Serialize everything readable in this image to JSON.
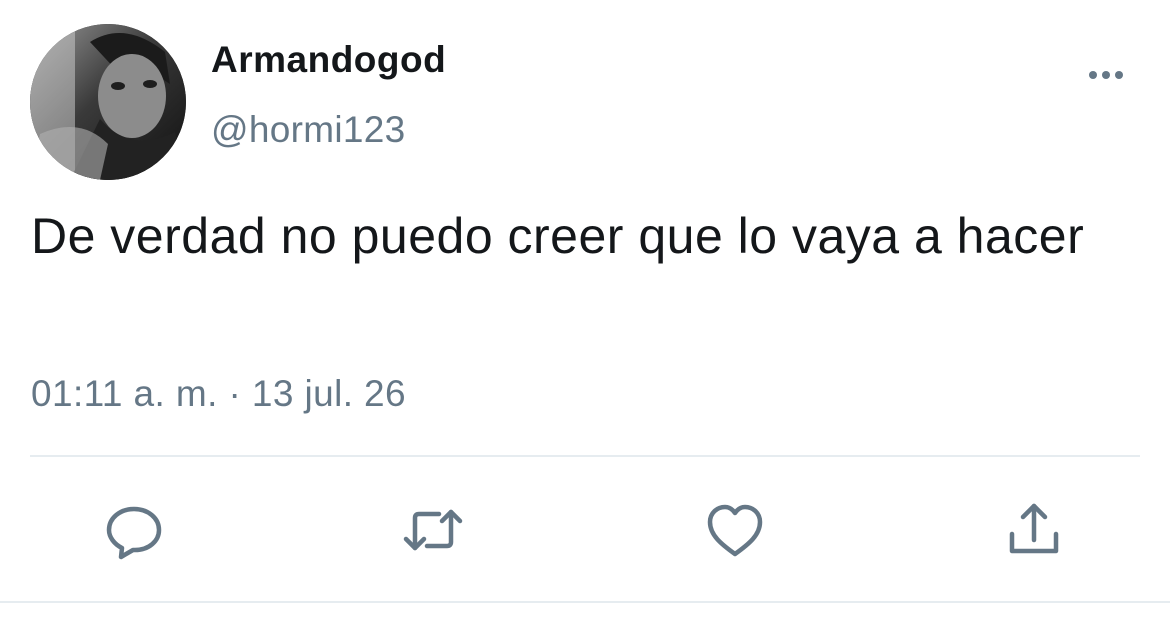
{
  "tweet": {
    "display_name": "Armandogod",
    "handle": "@hormi123",
    "text": "De verdad no puedo creer que lo vaya a hacer",
    "timestamp": "01:11 a. m. · 13 jul. 26"
  },
  "icons": {
    "more": "more-horizontal-icon",
    "reply": "reply-icon",
    "retweet": "retweet-icon",
    "like": "heart-icon",
    "share": "share-icon"
  },
  "colors": {
    "text_primary": "#14171a",
    "text_secondary": "#657786",
    "icon": "#657786",
    "divider": "#e6ecf0"
  }
}
